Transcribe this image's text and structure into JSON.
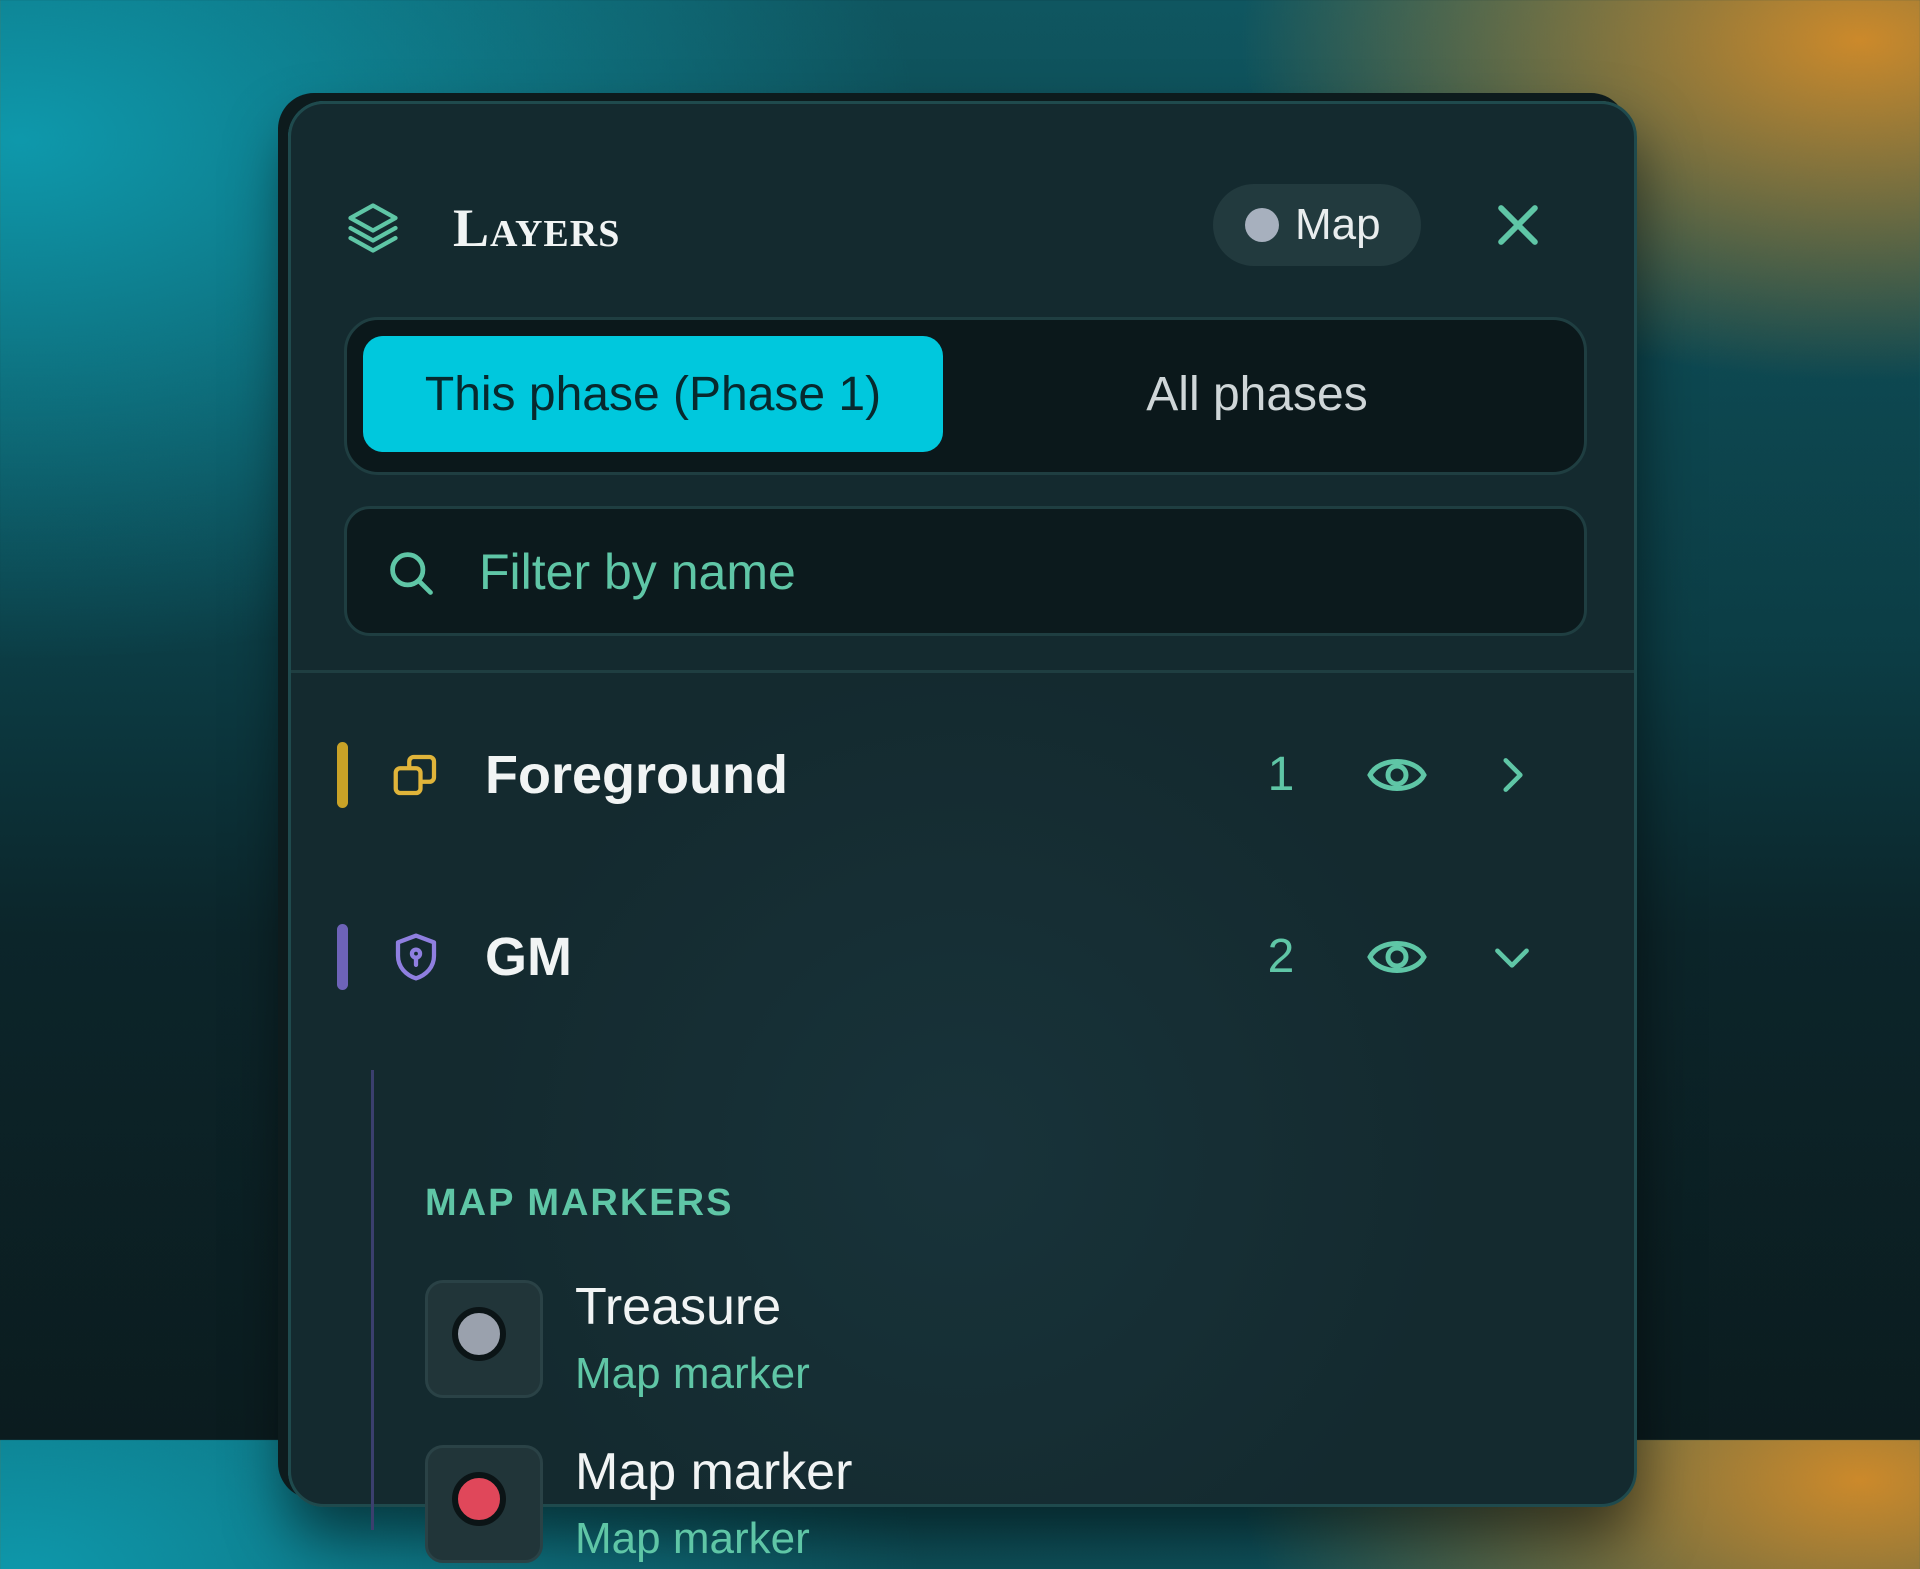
{
  "header": {
    "title": "Layers",
    "mode_badge": "Map",
    "mode_badge_color": "#a7b0be",
    "close_icon": "close-icon"
  },
  "phase_tabs": [
    {
      "label": "This phase (Phase 1)",
      "active": true
    },
    {
      "label": "All phases",
      "active": false
    }
  ],
  "search": {
    "placeholder": "Filter by name",
    "value": ""
  },
  "layers": [
    {
      "name": "Foreground",
      "count": "1",
      "accent": "#c9a227",
      "icon": "copy-icon",
      "expanded": false
    },
    {
      "name": "GM",
      "count": "2",
      "accent": "#6e63b8",
      "icon": "shield-icon",
      "expanded": true
    }
  ],
  "gm_section": {
    "label": "MAP MARKERS",
    "items": [
      {
        "name": "Treasure",
        "type": "Map marker",
        "color": "#9aa1ad"
      },
      {
        "name": "Map marker",
        "type": "Map marker",
        "color": "#e0475a"
      }
    ]
  },
  "colors": {
    "accent_cyan": "#00c8dd",
    "text_green": "#5fc6a6"
  }
}
